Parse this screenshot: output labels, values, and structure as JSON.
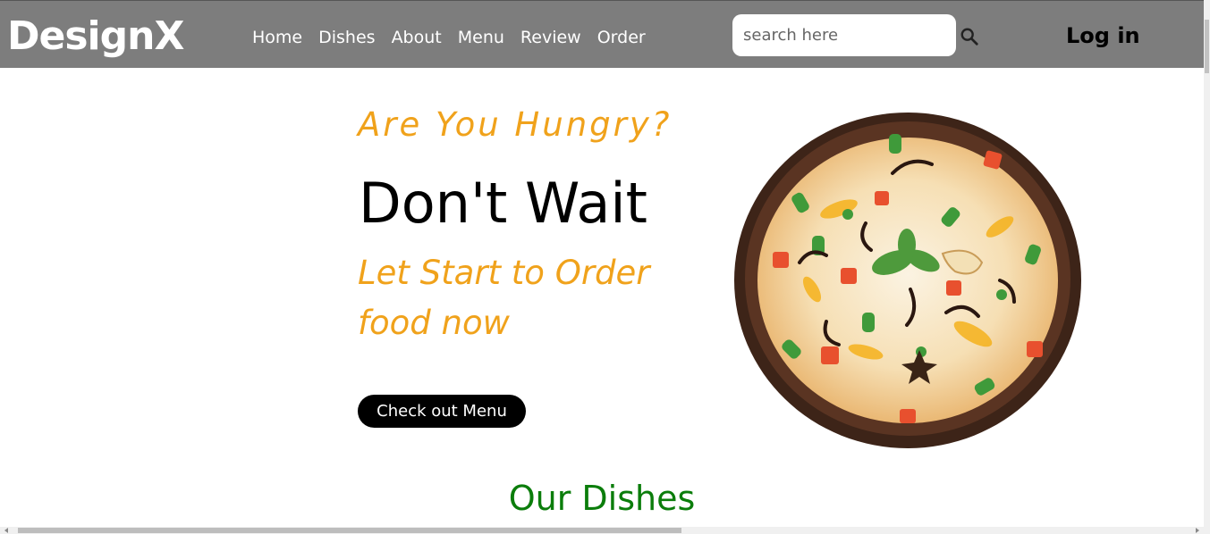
{
  "brand": {
    "name": "DesignX"
  },
  "nav": {
    "links": [
      "Home",
      "Dishes",
      "About",
      "Menu",
      "Review",
      "Order"
    ],
    "search_placeholder": "search here",
    "login_label": "Log in"
  },
  "hero": {
    "subtitle": "Are You Hungry?",
    "title": "Don't Wait",
    "tagline": "Let Start to Order food now",
    "cta_label": "Check out Menu",
    "image_icon": "biryani-bowl"
  },
  "sections": {
    "dishes_title": "Our Dishes"
  },
  "colors": {
    "navbar": "#7d7d7d",
    "accent_orange": "#f0a21b",
    "section_green": "#0b7d0b",
    "button": "#000000"
  }
}
